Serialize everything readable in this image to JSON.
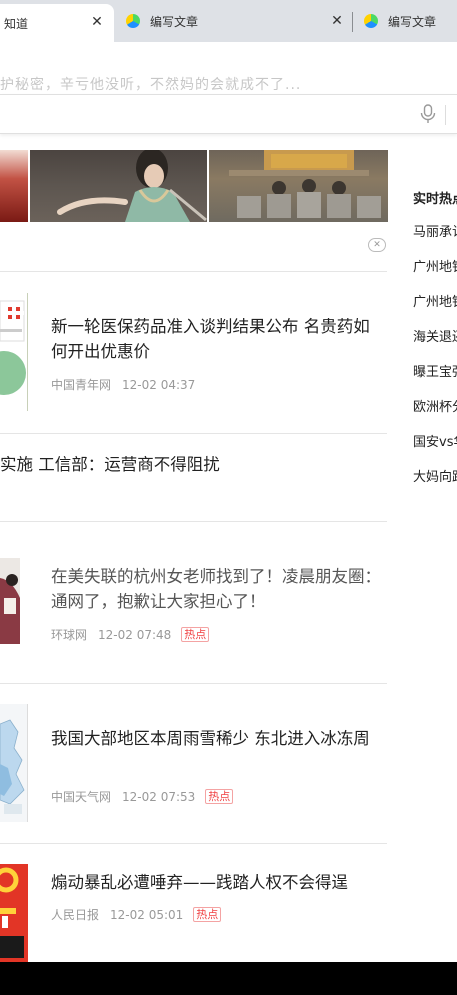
{
  "tabs": [
    {
      "label": "知道",
      "close": "✕"
    },
    {
      "label": "编写文章",
      "close": "✕"
    },
    {
      "label": "编写文章"
    }
  ],
  "marquee": "护秘密，辛亏他没听，不然妈的会就成不了...",
  "search": {
    "placeholder": "",
    "mic_icon": "microphone-icon"
  },
  "ad_close_glyph": "✕",
  "news": [
    {
      "title": "新一轮医保药品准入谈判结果公布 名贵药如何开出优惠价",
      "source": "中国青年网",
      "time": "12-02 04:37",
      "badge": ""
    },
    {
      "title": "实施 工信部：运营商不得阻扰"
    },
    {
      "title": "在美失联的杭州女老师找到了！凌晨朋友圈：通网了，抱歉让大家担心了！",
      "source": "环球网",
      "time": "12-02 07:48",
      "badge": "热点"
    },
    {
      "title": "我国大部地区本周雨雪稀少 东北进入冰冻周",
      "source": "中国天气网",
      "time": "12-02 07:53",
      "badge": "热点"
    },
    {
      "title": "煽动暴乱必遭唾弃——践踏人权不会得逞",
      "source": "人民日报",
      "time": "12-02 05:01",
      "badge": "热点"
    }
  ],
  "sidebar": {
    "title": "实时热点",
    "items": [
      "马丽承认",
      "广州地铁",
      "广州地铁",
      "海关退还",
      "曝王宝强",
      "欧洲杯分",
      "国安vs华",
      "大妈向路"
    ]
  },
  "colors": {
    "hot_badge": "#f04142",
    "tab_bar": "#dee1e6"
  }
}
